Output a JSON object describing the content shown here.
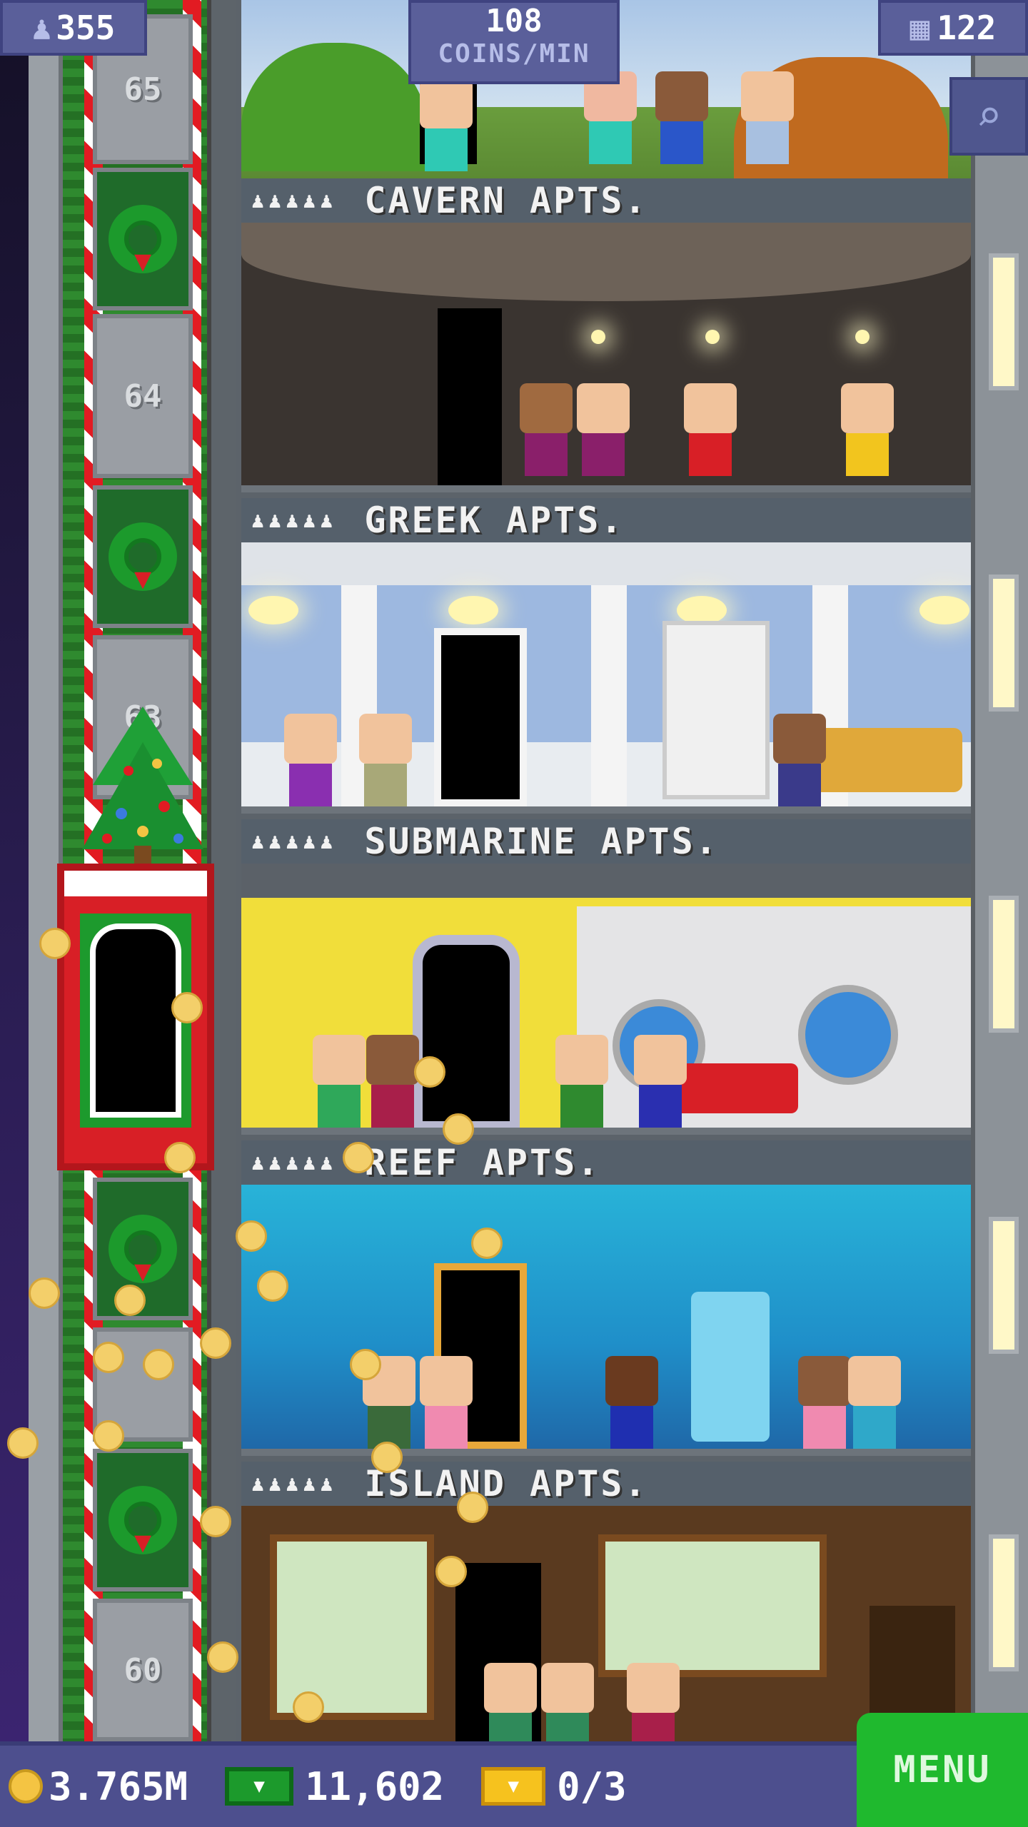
{
  "header": {
    "population": "355",
    "coins_per_min_value": "108",
    "coins_per_min_label": "COINS/MIN",
    "floors": "122"
  },
  "shaft": {
    "floor_numbers": [
      "65",
      "64",
      "63",
      "60"
    ]
  },
  "floors": [
    {
      "name": "CAVERN APTS.",
      "people": "♟♟♟♟♟"
    },
    {
      "name": "GREEK APTS.",
      "people": "♟♟♟♟♟"
    },
    {
      "name": "SUBMARINE APTS.",
      "people": "♟♟♟♟♟"
    },
    {
      "name": "REEF APTS.",
      "people": "♟♟♟♟♟"
    },
    {
      "name": "ISLAND APTS.",
      "people": "♟♟♟♟♟"
    }
  ],
  "bottom_bar": {
    "coins": "3.765M",
    "bux": "11,602",
    "tickets": "0/3",
    "menu_label": "MENU"
  },
  "colors": {
    "shaft_green": "#2f8a2f",
    "elevator_red": "#d81f26",
    "menu_green": "#1fb92e",
    "panel_blue": "#5a5f9a"
  },
  "icons": {
    "population": "person-icon",
    "floors": "building-icon",
    "search": "magnifier-icon",
    "coins": "coin-icon",
    "bux": "tower-bux-icon",
    "tickets": "golden-ticket-icon"
  }
}
